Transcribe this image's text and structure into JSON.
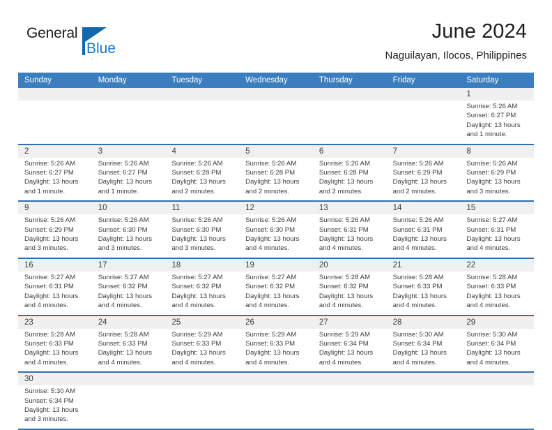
{
  "brand": {
    "name_part1": "General",
    "name_part2": "Blue",
    "accent_color": "#1878c8",
    "logo_mark_color": "#1268ad"
  },
  "header": {
    "title": "June 2024",
    "subtitle": "Naguilayan, Ilocos, Philippines"
  },
  "theme": {
    "header_row_bg": "#3a7ec0",
    "header_row_text": "#ffffff",
    "row_separator": "#2f6fac",
    "date_band_bg": "#f0f0f0",
    "body_text": "#3d3d3d"
  },
  "calendar": {
    "weekdays": [
      "Sunday",
      "Monday",
      "Tuesday",
      "Wednesday",
      "Thursday",
      "Friday",
      "Saturday"
    ],
    "labels": {
      "sunrise_prefix": "Sunrise:",
      "sunset_prefix": "Sunset:",
      "daylight_prefix": "Daylight:"
    },
    "weeks": [
      [
        {
          "date": "",
          "lines": []
        },
        {
          "date": "",
          "lines": []
        },
        {
          "date": "",
          "lines": []
        },
        {
          "date": "",
          "lines": []
        },
        {
          "date": "",
          "lines": []
        },
        {
          "date": "",
          "lines": []
        },
        {
          "date": "1",
          "lines": [
            "Sunrise: 5:26 AM",
            "Sunset: 6:27 PM",
            "Daylight: 13 hours",
            "and 1 minute."
          ]
        }
      ],
      [
        {
          "date": "2",
          "lines": [
            "Sunrise: 5:26 AM",
            "Sunset: 6:27 PM",
            "Daylight: 13 hours",
            "and 1 minute."
          ]
        },
        {
          "date": "3",
          "lines": [
            "Sunrise: 5:26 AM",
            "Sunset: 6:27 PM",
            "Daylight: 13 hours",
            "and 1 minute."
          ]
        },
        {
          "date": "4",
          "lines": [
            "Sunrise: 5:26 AM",
            "Sunset: 6:28 PM",
            "Daylight: 13 hours",
            "and 2 minutes."
          ]
        },
        {
          "date": "5",
          "lines": [
            "Sunrise: 5:26 AM",
            "Sunset: 6:28 PM",
            "Daylight: 13 hours",
            "and 2 minutes."
          ]
        },
        {
          "date": "6",
          "lines": [
            "Sunrise: 5:26 AM",
            "Sunset: 6:28 PM",
            "Daylight: 13 hours",
            "and 2 minutes."
          ]
        },
        {
          "date": "7",
          "lines": [
            "Sunrise: 5:26 AM",
            "Sunset: 6:29 PM",
            "Daylight: 13 hours",
            "and 2 minutes."
          ]
        },
        {
          "date": "8",
          "lines": [
            "Sunrise: 5:26 AM",
            "Sunset: 6:29 PM",
            "Daylight: 13 hours",
            "and 3 minutes."
          ]
        }
      ],
      [
        {
          "date": "9",
          "lines": [
            "Sunrise: 5:26 AM",
            "Sunset: 6:29 PM",
            "Daylight: 13 hours",
            "and 3 minutes."
          ]
        },
        {
          "date": "10",
          "lines": [
            "Sunrise: 5:26 AM",
            "Sunset: 6:30 PM",
            "Daylight: 13 hours",
            "and 3 minutes."
          ]
        },
        {
          "date": "11",
          "lines": [
            "Sunrise: 5:26 AM",
            "Sunset: 6:30 PM",
            "Daylight: 13 hours",
            "and 3 minutes."
          ]
        },
        {
          "date": "12",
          "lines": [
            "Sunrise: 5:26 AM",
            "Sunset: 6:30 PM",
            "Daylight: 13 hours",
            "and 4 minutes."
          ]
        },
        {
          "date": "13",
          "lines": [
            "Sunrise: 5:26 AM",
            "Sunset: 6:31 PM",
            "Daylight: 13 hours",
            "and 4 minutes."
          ]
        },
        {
          "date": "14",
          "lines": [
            "Sunrise: 5:26 AM",
            "Sunset: 6:31 PM",
            "Daylight: 13 hours",
            "and 4 minutes."
          ]
        },
        {
          "date": "15",
          "lines": [
            "Sunrise: 5:27 AM",
            "Sunset: 6:31 PM",
            "Daylight: 13 hours",
            "and 4 minutes."
          ]
        }
      ],
      [
        {
          "date": "16",
          "lines": [
            "Sunrise: 5:27 AM",
            "Sunset: 6:31 PM",
            "Daylight: 13 hours",
            "and 4 minutes."
          ]
        },
        {
          "date": "17",
          "lines": [
            "Sunrise: 5:27 AM",
            "Sunset: 6:32 PM",
            "Daylight: 13 hours",
            "and 4 minutes."
          ]
        },
        {
          "date": "18",
          "lines": [
            "Sunrise: 5:27 AM",
            "Sunset: 6:32 PM",
            "Daylight: 13 hours",
            "and 4 minutes."
          ]
        },
        {
          "date": "19",
          "lines": [
            "Sunrise: 5:27 AM",
            "Sunset: 6:32 PM",
            "Daylight: 13 hours",
            "and 4 minutes."
          ]
        },
        {
          "date": "20",
          "lines": [
            "Sunrise: 5:28 AM",
            "Sunset: 6:32 PM",
            "Daylight: 13 hours",
            "and 4 minutes."
          ]
        },
        {
          "date": "21",
          "lines": [
            "Sunrise: 5:28 AM",
            "Sunset: 6:33 PM",
            "Daylight: 13 hours",
            "and 4 minutes."
          ]
        },
        {
          "date": "22",
          "lines": [
            "Sunrise: 5:28 AM",
            "Sunset: 6:33 PM",
            "Daylight: 13 hours",
            "and 4 minutes."
          ]
        }
      ],
      [
        {
          "date": "23",
          "lines": [
            "Sunrise: 5:28 AM",
            "Sunset: 6:33 PM",
            "Daylight: 13 hours",
            "and 4 minutes."
          ]
        },
        {
          "date": "24",
          "lines": [
            "Sunrise: 5:28 AM",
            "Sunset: 6:33 PM",
            "Daylight: 13 hours",
            "and 4 minutes."
          ]
        },
        {
          "date": "25",
          "lines": [
            "Sunrise: 5:29 AM",
            "Sunset: 6:33 PM",
            "Daylight: 13 hours",
            "and 4 minutes."
          ]
        },
        {
          "date": "26",
          "lines": [
            "Sunrise: 5:29 AM",
            "Sunset: 6:33 PM",
            "Daylight: 13 hours",
            "and 4 minutes."
          ]
        },
        {
          "date": "27",
          "lines": [
            "Sunrise: 5:29 AM",
            "Sunset: 6:34 PM",
            "Daylight: 13 hours",
            "and 4 minutes."
          ]
        },
        {
          "date": "28",
          "lines": [
            "Sunrise: 5:30 AM",
            "Sunset: 6:34 PM",
            "Daylight: 13 hours",
            "and 4 minutes."
          ]
        },
        {
          "date": "29",
          "lines": [
            "Sunrise: 5:30 AM",
            "Sunset: 6:34 PM",
            "Daylight: 13 hours",
            "and 4 minutes."
          ]
        }
      ],
      [
        {
          "date": "30",
          "lines": [
            "Sunrise: 5:30 AM",
            "Sunset: 6:34 PM",
            "Daylight: 13 hours",
            "and 3 minutes."
          ]
        },
        {
          "date": "",
          "lines": []
        },
        {
          "date": "",
          "lines": []
        },
        {
          "date": "",
          "lines": []
        },
        {
          "date": "",
          "lines": []
        },
        {
          "date": "",
          "lines": []
        },
        {
          "date": "",
          "lines": []
        }
      ]
    ]
  }
}
